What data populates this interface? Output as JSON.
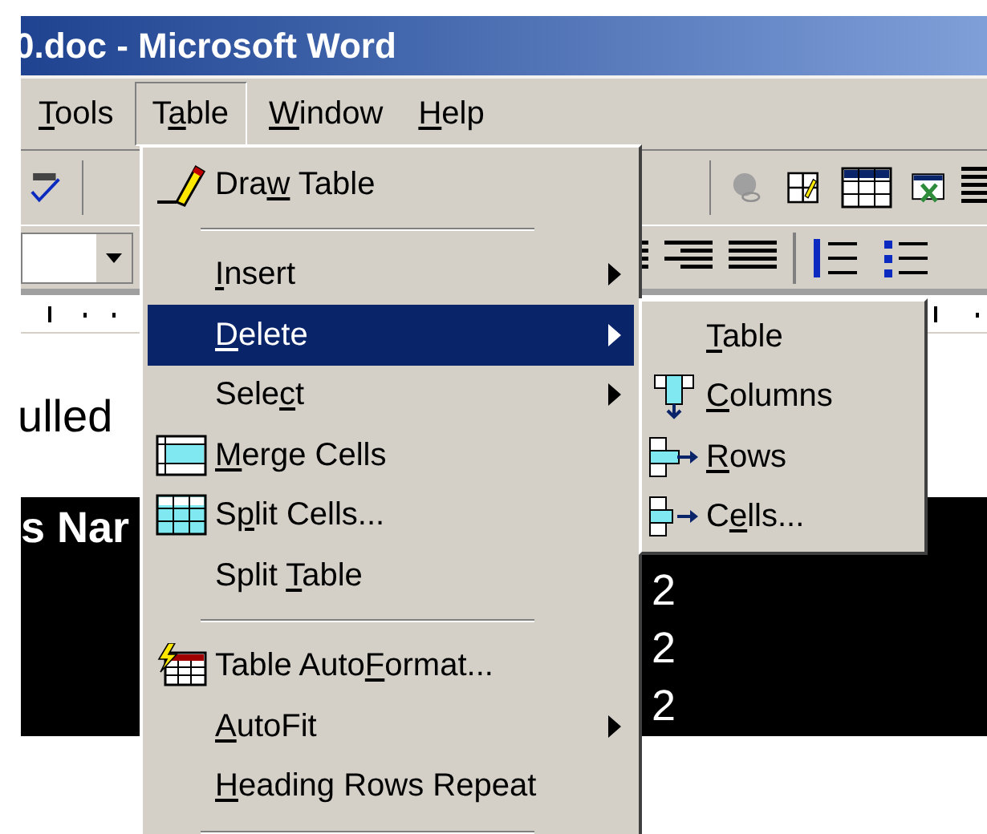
{
  "window": {
    "title": "0.doc - Microsoft Word"
  },
  "menu_bar": [
    {
      "text": {
        "key": "T",
        "post": "ools"
      },
      "selected": false
    },
    {
      "text": {
        "pre": "T",
        "key": "a",
        "post": "ble"
      },
      "selected": true
    },
    {
      "text": {
        "key": "W",
        "post": "indow"
      },
      "selected": false
    },
    {
      "text": {
        "key": "H",
        "post": "elp"
      },
      "selected": false
    }
  ],
  "table_menu": [
    {
      "kind": "item",
      "text": {
        "pre": "Dra",
        "key": "w",
        "post": " Table"
      },
      "submenu": false,
      "selected": false
    },
    {
      "kind": "separator"
    },
    {
      "kind": "item",
      "text": {
        "key": "I",
        "post": "nsert"
      },
      "submenu": true,
      "selected": false
    },
    {
      "kind": "item",
      "text": {
        "key": "D",
        "post": "elete"
      },
      "submenu": true,
      "selected": true
    },
    {
      "kind": "item",
      "text": {
        "pre": "Sele",
        "key": "c",
        "post": "t"
      },
      "submenu": true,
      "selected": false
    },
    {
      "kind": "item",
      "text": {
        "key": "M",
        "post": "erge Cells"
      },
      "submenu": false,
      "selected": false
    },
    {
      "kind": "item",
      "text": {
        "pre": "S",
        "key": "p",
        "post": "lit Cells..."
      },
      "submenu": false,
      "selected": false
    },
    {
      "kind": "item",
      "text": {
        "pre": "Split ",
        "key": "T",
        "post": "able"
      },
      "submenu": false,
      "selected": false
    },
    {
      "kind": "separator"
    },
    {
      "kind": "item",
      "text": {
        "pre": "Table Auto",
        "key": "F",
        "post": "ormat..."
      },
      "submenu": false,
      "selected": false
    },
    {
      "kind": "item",
      "text": {
        "key": "A",
        "post": "utoFit"
      },
      "submenu": true,
      "selected": false
    },
    {
      "kind": "item",
      "text": {
        "key": "H",
        "post": "eading Rows Repeat"
      },
      "submenu": false,
      "selected": false
    },
    {
      "kind": "separator"
    }
  ],
  "delete_submenu": [
    {
      "text": {
        "key": "T",
        "post": "able"
      },
      "selected": false
    },
    {
      "text": {
        "key": "C",
        "post": "olumns"
      },
      "selected": false
    },
    {
      "text": {
        "key": "R",
        "post": "ows"
      },
      "selected": false
    },
    {
      "text": {
        "pre": "C",
        "key": "e",
        "post": "lls..."
      },
      "selected": false
    }
  ],
  "document": {
    "text_fragment": "ulled",
    "table_header": "s Nar",
    "table_cells": [
      "2",
      "2",
      "2"
    ]
  }
}
